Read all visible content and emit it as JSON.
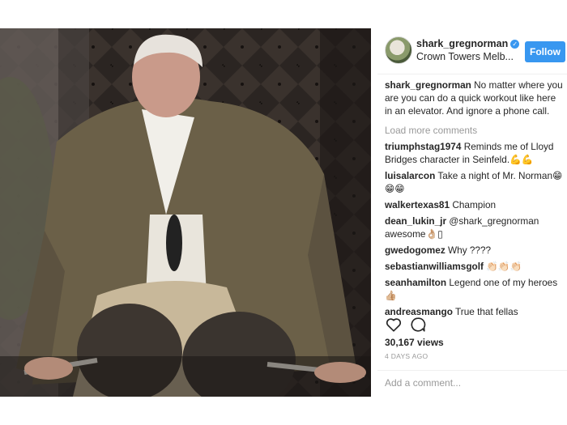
{
  "header": {
    "username": "shark_gregnorman",
    "location": "Crown Towers Melb...",
    "follow_label": "Follow"
  },
  "caption": {
    "username": "shark_gregnorman",
    "text": "No matter where you are you can do a quick workout like here in an elevator. And ignore a phone call."
  },
  "load_more": "Load more comments",
  "comments": [
    {
      "user": "triumphstag1974",
      "text": "Reminds me of Lloyd Bridges character in Seinfeld.",
      "emoji": "💪💪"
    },
    {
      "user": "luisalarcon",
      "text": "Take a night of Mr. Norman",
      "emoji": "😁😁😁"
    },
    {
      "user": "walkertexas81",
      "text": "Champion",
      "emoji": ""
    },
    {
      "user": "dean_lukin_jr",
      "text": "@shark_gregnorman awesome",
      "emoji": "👌🏼▯"
    },
    {
      "user": "gwedogomez",
      "text": "Why ????",
      "emoji": ""
    },
    {
      "user": "sebastianwilliamsgolf",
      "text": "",
      "emoji": "👏🏻👏🏻👏🏻"
    },
    {
      "user": "seanhamilton",
      "text": "Legend one of my heroes",
      "emoji": "👍🏼"
    },
    {
      "user": "andreasmango",
      "text": "True that fellas",
      "emoji": ""
    }
  ],
  "actions": {
    "like_icon": "heart-icon",
    "comment_icon": "comment-icon"
  },
  "views": "30,167 views",
  "time_ago": "4 DAYS AGO",
  "add_comment_placeholder": "Add a comment..."
}
